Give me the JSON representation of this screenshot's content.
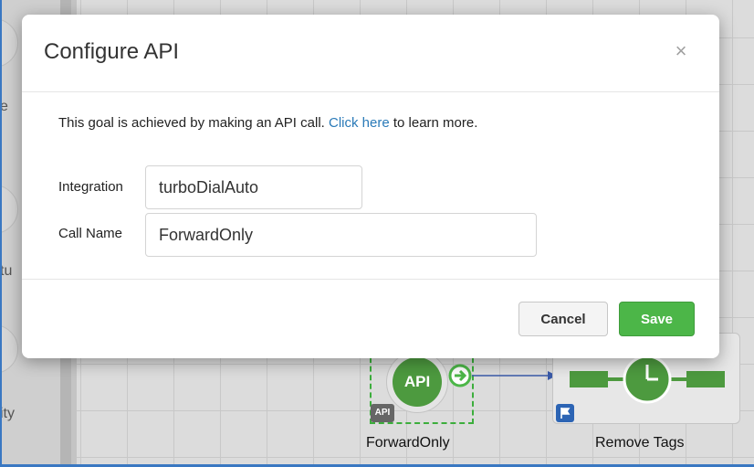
{
  "background": {
    "left_fragments": [
      "e",
      "tu",
      "ity"
    ],
    "nodes": [
      {
        "badge": "API",
        "node_text": "API",
        "label": "ForwardOnly"
      },
      {
        "label": "Remove Tags"
      }
    ]
  },
  "modal": {
    "title": "Configure API",
    "close_glyph": "×",
    "intro_text": "This goal is achieved by making an API call.",
    "link_text": "Click here",
    "intro_suffix": "to learn more.",
    "integration": {
      "label": "Integration",
      "value": "turboDialAuto"
    },
    "call_name": {
      "label": "Call Name",
      "value": "ForwardOnly"
    },
    "cancel_label": "Cancel",
    "save_label": "Save"
  },
  "colors": {
    "accent_link": "#2a7ab8",
    "save_green": "#4cb648",
    "node_green": "#4d9a3f",
    "flow_blue": "#3a5aa8"
  }
}
